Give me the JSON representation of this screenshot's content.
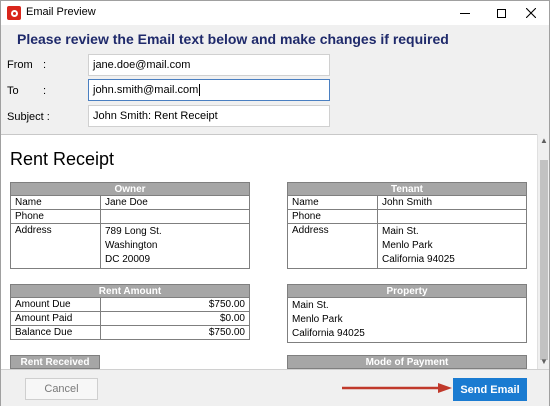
{
  "window": {
    "title": "Email Preview"
  },
  "header": {
    "text": "Please review the Email text below and make changes if required"
  },
  "form": {
    "from_label": "From",
    "to_label": "To",
    "subject_label": "Subject :",
    "colon": ":",
    "from_value": "jane.doe@mail.com",
    "to_value": "john.smith@mail.com",
    "subject_value": "John Smith: Rent Receipt"
  },
  "document": {
    "title": "Rent Receipt",
    "owner": {
      "header": "Owner",
      "name_label": "Name",
      "name": "Jane Doe",
      "phone_label": "Phone",
      "phone": "",
      "address_label": "Address",
      "address_line1": "789 Long St.",
      "address_line2": "Washington",
      "address_line3": "DC 20009"
    },
    "tenant": {
      "header": "Tenant",
      "name_label": "Name",
      "name": "John Smith",
      "phone_label": "Phone",
      "phone": "",
      "address_label": "Address",
      "address_line1": "Main St.",
      "address_line2": "Menlo Park",
      "address_line3": "California 94025"
    },
    "rent_amount": {
      "header": "Rent Amount",
      "rows": [
        {
          "label": "Amount Due",
          "value": "$750.00"
        },
        {
          "label": "Amount Paid",
          "value": "$0.00"
        },
        {
          "label": "Balance Due",
          "value": "$750.00"
        }
      ]
    },
    "property": {
      "header": "Property",
      "line1": "Main St.",
      "line2": "Menlo Park",
      "line3": "California 94025"
    },
    "rent_received": {
      "header": "Rent Received"
    },
    "mode_of_payment": {
      "header": "Mode of Payment"
    }
  },
  "buttons": {
    "cancel": "Cancel",
    "send": "Send Email"
  },
  "colors": {
    "header_blue": "#1f2a6b",
    "send_button": "#1a7bd1",
    "arrow_red": "#c0392b",
    "table_header": "#a6a6a6"
  }
}
